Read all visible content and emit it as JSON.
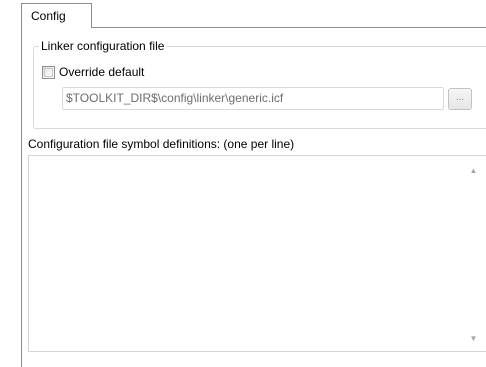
{
  "tabs": [
    {
      "label": "Config"
    }
  ],
  "linker_group": {
    "title": "Linker configuration file",
    "override_checkbox": {
      "label": "Override default",
      "checked": false
    },
    "config_path": {
      "value": "$TOOLKIT_DIR$\\config\\linker\\generic.icf",
      "enabled": false
    },
    "browse_button": {
      "label": "...",
      "enabled": false
    }
  },
  "symbol_definitions": {
    "label": "Configuration file symbol definitions: (one per line)",
    "value": ""
  },
  "icons": {
    "scroll_up": "up-arrow-icon",
    "scroll_down": "down-arrow-icon"
  },
  "colors": {
    "disabled_text": "#6d6d6d",
    "border": "#8c8e94"
  }
}
